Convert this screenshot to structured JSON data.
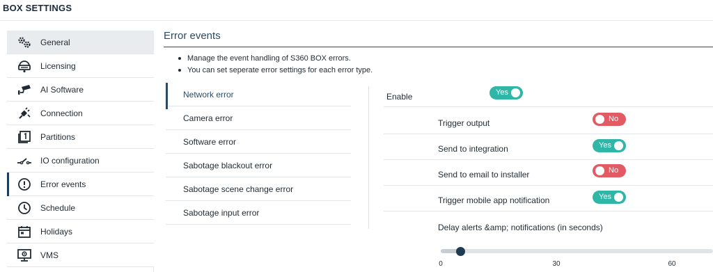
{
  "app": {
    "title": "BOX SETTINGS"
  },
  "sidebar": {
    "items": [
      {
        "label": "General",
        "icon": "gears-icon"
      },
      {
        "label": "Licensing",
        "icon": "license-icon"
      },
      {
        "label": "AI Software",
        "icon": "cctv-camera-icon"
      },
      {
        "label": "Connection",
        "icon": "plug-icon"
      },
      {
        "label": "Partitions",
        "icon": "partition-icon"
      },
      {
        "label": "IO configuration",
        "icon": "switch-icon"
      },
      {
        "label": "Error events",
        "icon": "alert-circle-icon"
      },
      {
        "label": "Schedule",
        "icon": "clock-icon"
      },
      {
        "label": "Holidays",
        "icon": "calendar-icon"
      },
      {
        "label": "VMS",
        "icon": "monitor-icon"
      }
    ]
  },
  "main": {
    "title": "Error events",
    "bullets": [
      "Manage the event handling of S360 BOX errors.",
      "You can set seperate error settings for each error type."
    ],
    "error_types": [
      "Network error",
      "Camera error",
      "Software error",
      "Sabotage blackout error",
      "Sabotage scene change error",
      "Sabotage input error"
    ],
    "settings": {
      "enable": {
        "label": "Enable",
        "value": "Yes"
      },
      "trigger_output": {
        "label": "Trigger output",
        "value": "No"
      },
      "send_to_integration": {
        "label": "Send to integration",
        "value": "Yes"
      },
      "send_email_installer": {
        "label": "Send to email to installer",
        "value": "No"
      },
      "trigger_mobile": {
        "label": "Trigger mobile app notification",
        "value": "Yes"
      },
      "delay": {
        "label": "Delay alerts &amp; notifications (in seconds)",
        "value": 5,
        "ticks": [
          "0",
          "30",
          "60"
        ]
      }
    }
  },
  "colors": {
    "accent": "#2b4a66",
    "toggle_on": "#2fb6a7",
    "toggle_off": "#e25a63",
    "slider_thumb": "#1f3b52"
  }
}
